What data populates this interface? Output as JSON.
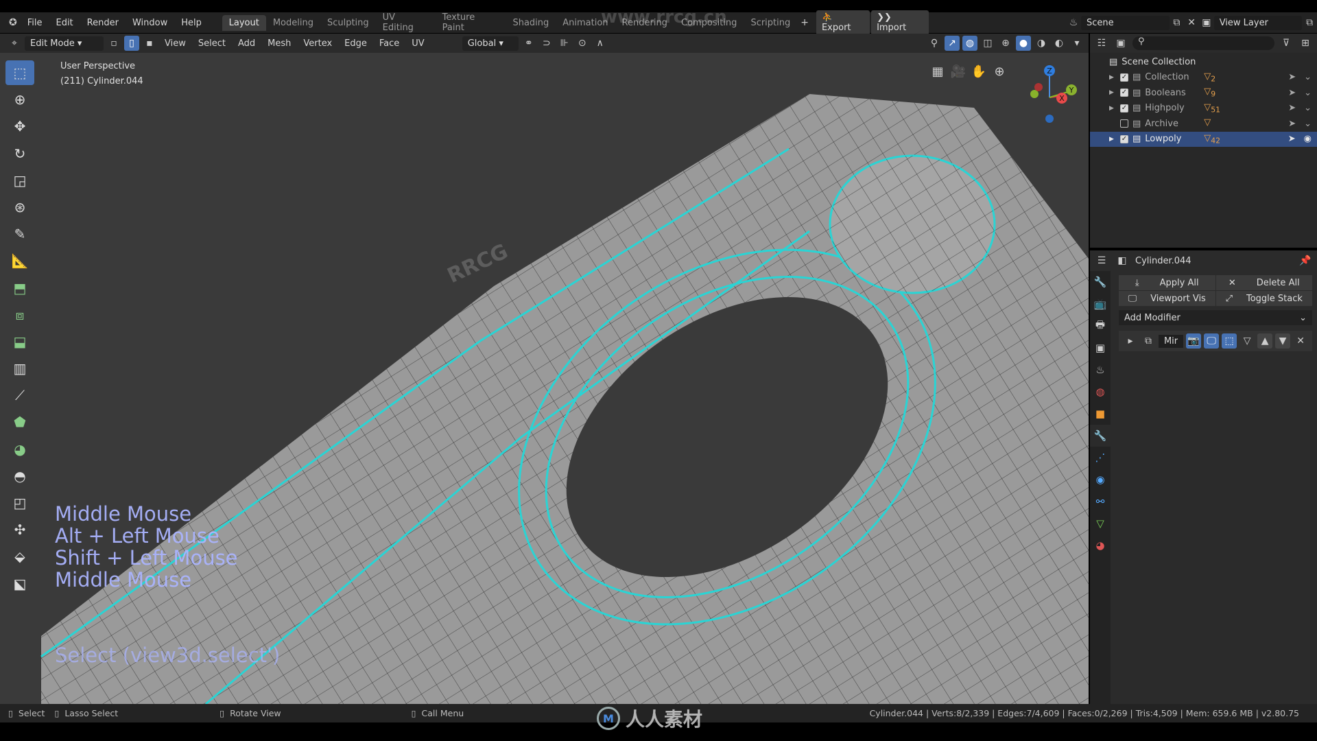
{
  "app": {
    "menus": [
      "File",
      "Edit",
      "Render",
      "Window",
      "Help"
    ],
    "workspaces": [
      "Layout",
      "Modeling",
      "Sculpting",
      "UV Editing",
      "Texture Paint",
      "Shading",
      "Animation",
      "Rendering",
      "Compositing",
      "Scripting"
    ],
    "active_workspace": "Layout",
    "export_label": "Export",
    "import_label": "Import",
    "scene": "Scene",
    "view_layer": "View Layer"
  },
  "header": {
    "mode": "Edit Mode",
    "menus": [
      "View",
      "Select",
      "Add",
      "Mesh",
      "Vertex",
      "Edge",
      "Face",
      "UV"
    ],
    "transform_orientation": "Global"
  },
  "viewport": {
    "view_name": "User Perspective",
    "object_info": "(211) Cylinder.044",
    "keys": [
      "Middle Mouse",
      "Alt + Left Mouse",
      "Shift + Left Mouse",
      "Middle Mouse"
    ],
    "operator": "Select (view3d.select')",
    "gizmo": {
      "x": "X",
      "y": "Y",
      "z": "Z"
    },
    "accent_color": "#2ad4d4"
  },
  "tools": [
    "select-box",
    "cursor",
    "move",
    "rotate",
    "scale",
    "transform",
    "annotate",
    "measure",
    "extrude",
    "inset",
    "bevel",
    "loop-cut",
    "knife",
    "poly-build",
    "spin",
    "smooth",
    "shrink-fatten",
    "shear",
    "rip",
    "edge-slide"
  ],
  "outliner": {
    "root": "Scene Collection",
    "items": [
      {
        "name": "Collection",
        "checked": true,
        "count": "2"
      },
      {
        "name": "Booleans",
        "checked": true,
        "count": "9"
      },
      {
        "name": "Highpoly",
        "checked": true,
        "count": "51"
      },
      {
        "name": "Archive",
        "checked": false,
        "count": ""
      },
      {
        "name": "Lowpoly",
        "checked": true,
        "count": "42",
        "selected": true
      }
    ]
  },
  "properties": {
    "object": "Cylinder.044",
    "apply_all": "Apply All",
    "delete_all": "Delete All",
    "viewport_vis": "Viewport Vis",
    "toggle_stack": "Toggle Stack",
    "add_modifier": "Add Modifier",
    "modifier_name": "Mir"
  },
  "status": {
    "select": "Select",
    "lasso": "Lasso Select",
    "rotate": "Rotate View",
    "call_menu": "Call Menu",
    "stats": "Cylinder.044 | Verts:8/2,339 | Edges:7/4,609 | Faces:0/2,269 | Tris:4,509 | Mem: 659.6 MB | v2.80.75"
  },
  "watermarks": {
    "site": "www.rrcg.cn",
    "brand": "人人素材",
    "rrcg": "RRCG"
  }
}
